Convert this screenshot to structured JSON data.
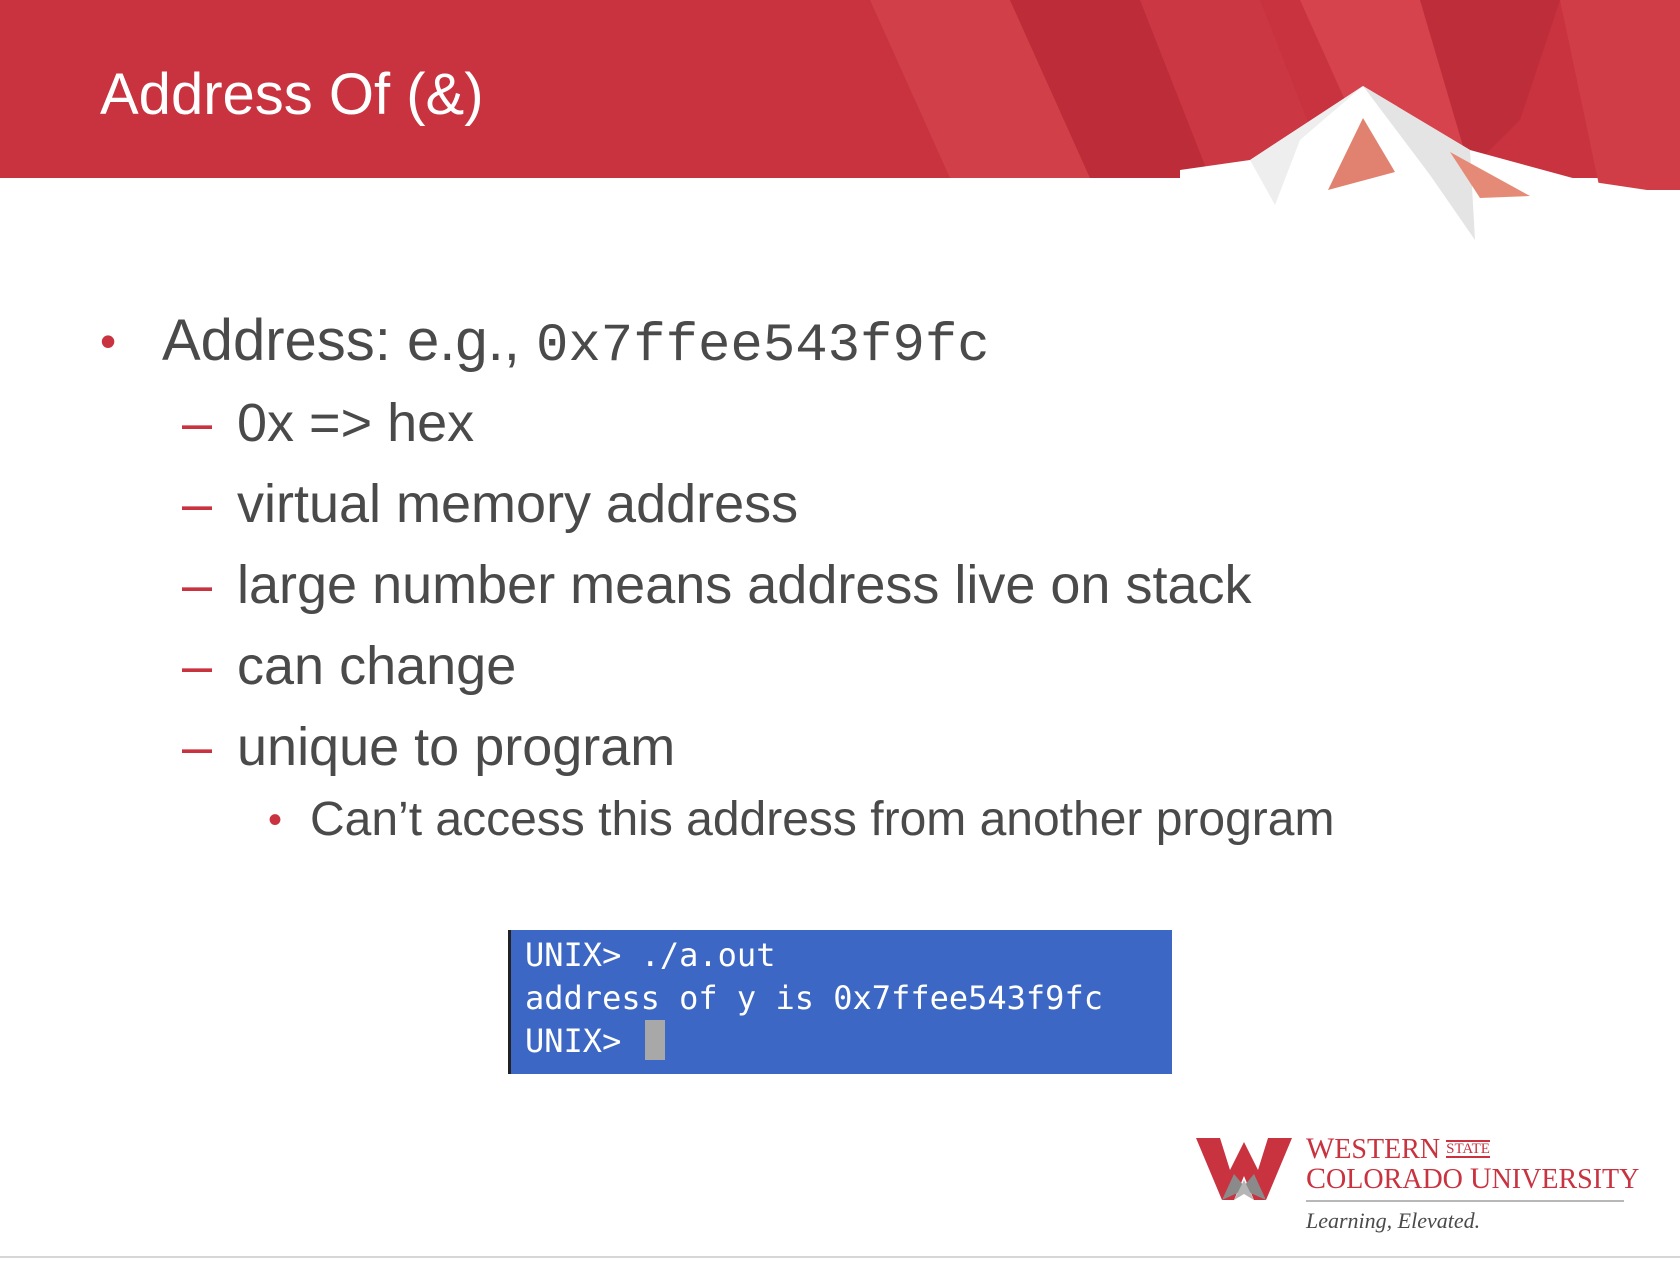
{
  "slide": {
    "title": "Address Of (&)"
  },
  "bullets": {
    "main": {
      "label": "Address: e.g., ",
      "code": "0x7ffee543f9fc"
    },
    "sub_items": [
      "0x => hex",
      "virtual memory address",
      "large number means address live on stack",
      "can change",
      "unique to program"
    ],
    "sub_sub_item": "Can’t access this address from another program",
    "bullet_glyph": "•",
    "dash_glyph": "–"
  },
  "terminal": {
    "lines": [
      "UNIX> ./a.out",
      "address of y is 0x7ffee543f9fc",
      "UNIX> "
    ],
    "background": "#3d67c4"
  },
  "logo": {
    "western_first": "W",
    "western_rest": "ESTERN",
    "state": "STATE",
    "colorado_first": "C",
    "colorado_rest": "OLORADO ",
    "university_first": "U",
    "university_rest": "NIVERSITY",
    "tagline": "Learning, Elevated.",
    "icon": "mountain-w-logo-icon"
  },
  "colors": {
    "brand_red": "#c9323f",
    "text_gray": "#4a4a4a"
  }
}
